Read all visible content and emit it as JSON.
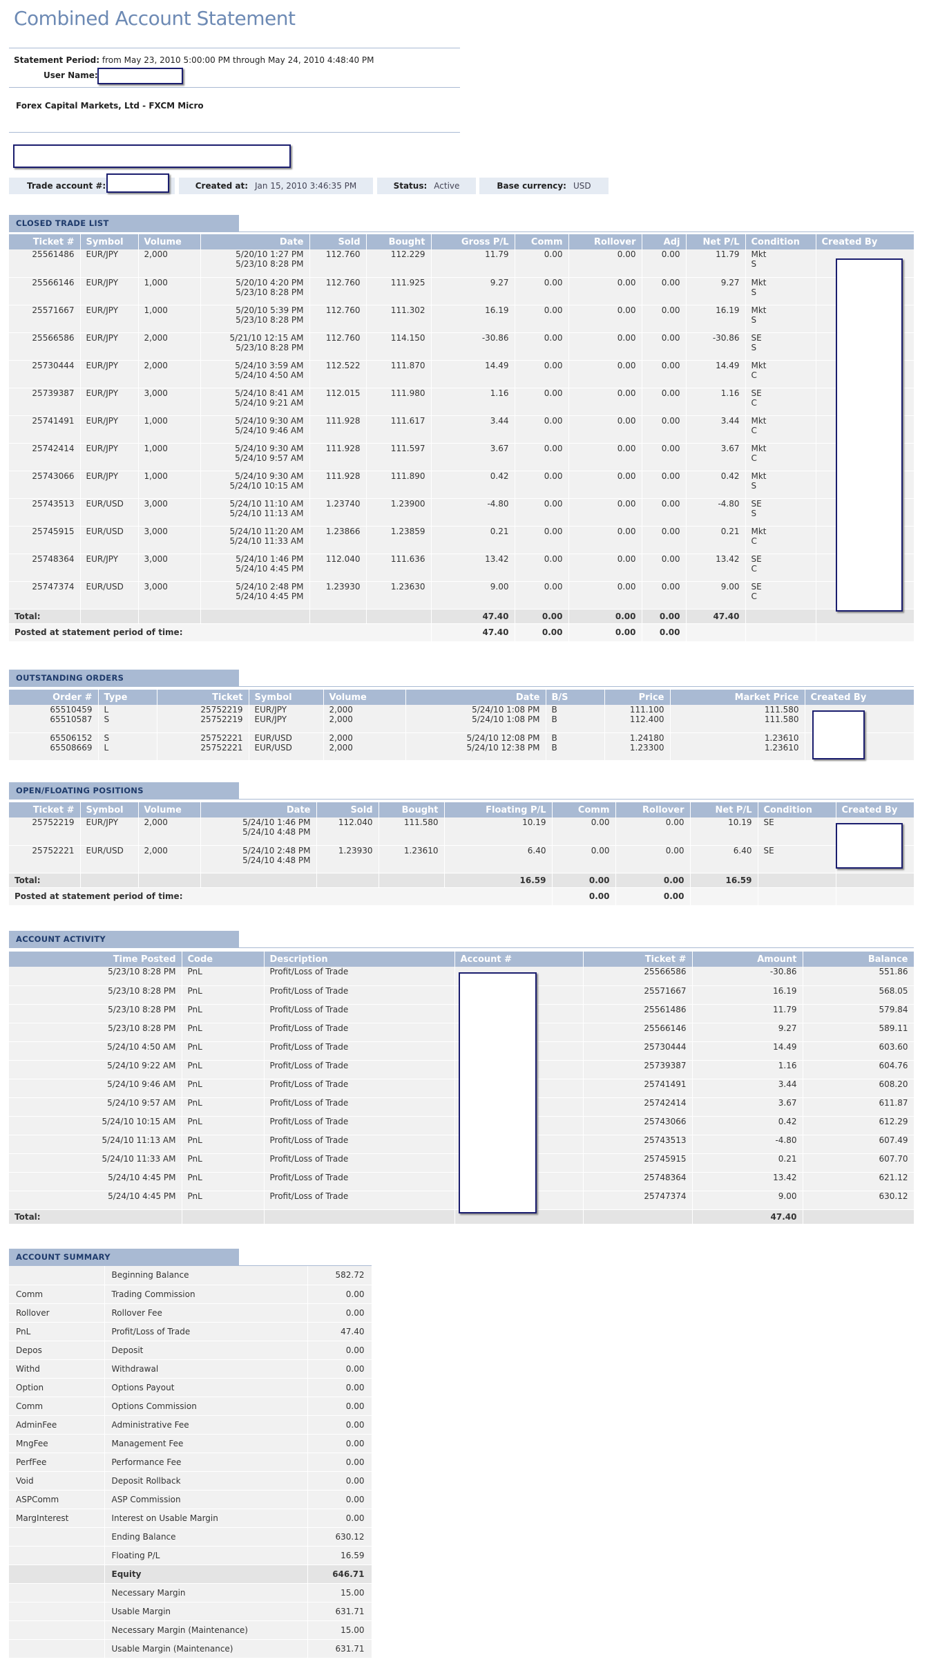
{
  "title": "Combined Account Statement",
  "period_label": "Statement Period:",
  "period_value": "from May 23, 2010 5:00:00 PM through May 24, 2010 4:48:40 PM",
  "user_label": "User Name:",
  "broker": "Forex Capital Markets, Ltd - FXCM Micro",
  "info": {
    "trade_account_label": "Trade account #:",
    "created_label": "Created at:",
    "created_value": "Jan 15, 2010 3:46:35 PM",
    "status_label": "Status:",
    "status_value": "Active",
    "currency_label": "Base currency:",
    "currency_value": "USD"
  },
  "closed": {
    "title": "CLOSED TRADE LIST",
    "headers": [
      "Ticket #",
      "Symbol",
      "Volume",
      "Date",
      "Sold",
      "Bought",
      "Gross P/L",
      "Comm",
      "Rollover",
      "Adj",
      "Net P/L",
      "Condition",
      "Created By"
    ],
    "rows": [
      [
        "25561486",
        "EUR/JPY",
        "2,000",
        "5/20/10 1:27 PM",
        "5/23/10 8:28 PM",
        "",
        "112.760",
        "112.229",
        "",
        "11.79",
        "0.00",
        "0.00",
        "0.00",
        "11.79",
        "Mkt",
        "S"
      ],
      [
        "25566146",
        "EUR/JPY",
        "1,000",
        "5/20/10 4:20 PM",
        "5/23/10 8:28 PM",
        "",
        "112.760",
        "111.925",
        "",
        "9.27",
        "0.00",
        "0.00",
        "0.00",
        "9.27",
        "Mkt",
        "S"
      ],
      [
        "25571667",
        "EUR/JPY",
        "1,000",
        "5/20/10 5:39 PM",
        "5/23/10 8:28 PM",
        "",
        "112.760",
        "111.302",
        "",
        "16.19",
        "0.00",
        "0.00",
        "0.00",
        "16.19",
        "Mkt",
        "S"
      ],
      [
        "25566586",
        "EUR/JPY",
        "2,000",
        "5/21/10 12:15 AM",
        "5/23/10 8:28 PM",
        "",
        "112.760",
        "114.150",
        "",
        "-30.86",
        "0.00",
        "0.00",
        "0.00",
        "-30.86",
        "SE",
        "S"
      ],
      [
        "25730444",
        "EUR/JPY",
        "2,000",
        "5/24/10 3:59 AM",
        "5/24/10 4:50 AM",
        "112.522",
        "",
        "",
        "111.870",
        "14.49",
        "0.00",
        "0.00",
        "0.00",
        "14.49",
        "Mkt",
        "C"
      ],
      [
        "25739387",
        "EUR/JPY",
        "3,000",
        "5/24/10 8:41 AM",
        "5/24/10 9:21 AM",
        "",
        "112.015",
        "111.980",
        "",
        "1.16",
        "0.00",
        "0.00",
        "0.00",
        "1.16",
        "SE",
        "C"
      ],
      [
        "25741491",
        "EUR/JPY",
        "1,000",
        "5/24/10 9:30 AM",
        "5/24/10 9:46 AM",
        "111.928",
        "",
        "",
        "111.617",
        "3.44",
        "0.00",
        "0.00",
        "0.00",
        "3.44",
        "Mkt",
        "C"
      ],
      [
        "25742414",
        "EUR/JPY",
        "1,000",
        "5/24/10 9:30 AM",
        "5/24/10 9:57 AM",
        "111.928",
        "",
        "",
        "111.597",
        "3.67",
        "0.00",
        "0.00",
        "0.00",
        "3.67",
        "Mkt",
        "C"
      ],
      [
        "25743066",
        "EUR/JPY",
        "1,000",
        "5/24/10 9:30 AM",
        "5/24/10 10:15 AM",
        "111.928",
        "",
        "",
        "111.890",
        "0.42",
        "0.00",
        "0.00",
        "0.00",
        "0.42",
        "Mkt",
        "S"
      ],
      [
        "25743513",
        "EUR/USD",
        "3,000",
        "5/24/10 11:10 AM",
        "5/24/10 11:13 AM",
        "",
        "1.23740",
        "1.23900",
        "",
        "-4.80",
        "0.00",
        "0.00",
        "0.00",
        "-4.80",
        "SE",
        "S"
      ],
      [
        "25745915",
        "EUR/USD",
        "3,000",
        "5/24/10 11:20 AM",
        "5/24/10 11:33 AM",
        "",
        "1.23866",
        "1.23859",
        "",
        "0.21",
        "0.00",
        "0.00",
        "0.00",
        "0.21",
        "Mkt",
        "C"
      ],
      [
        "25748364",
        "EUR/JPY",
        "3,000",
        "5/24/10 1:46 PM",
        "5/24/10 4:45 PM",
        "112.040",
        "",
        "",
        "111.636",
        "13.42",
        "0.00",
        "0.00",
        "0.00",
        "13.42",
        "SE",
        "C"
      ],
      [
        "25747374",
        "EUR/USD",
        "3,000",
        "5/24/10 2:48 PM",
        "5/24/10 4:45 PM",
        "1.23930",
        "",
        "",
        "1.23630",
        "9.00",
        "0.00",
        "0.00",
        "0.00",
        "9.00",
        "SE",
        "C"
      ]
    ],
    "total_label": "Total:",
    "total": {
      "gross": "47.40",
      "comm": "0.00",
      "rollover": "0.00",
      "adj": "0.00",
      "net": "47.40"
    },
    "posted_label": "Posted at statement period of time:",
    "posted": {
      "gross": "47.40",
      "comm": "0.00",
      "rollover": "0.00",
      "adj": "0.00"
    }
  },
  "orders": {
    "title": "OUTSTANDING ORDERS",
    "headers": [
      "Order #",
      "Type",
      "Ticket",
      "Symbol",
      "Volume",
      "Date",
      "B/S",
      "Price",
      "Market Price",
      "Created By"
    ],
    "rows": [
      [
        [
          "65510459",
          "65510587"
        ],
        [
          "L",
          "S"
        ],
        [
          "25752219",
          "25752219"
        ],
        [
          "EUR/JPY",
          "EUR/JPY"
        ],
        [
          "2,000",
          "2,000"
        ],
        [
          "5/24/10 1:08 PM",
          "5/24/10 1:08 PM"
        ],
        [
          "B",
          "B"
        ],
        [
          "111.100",
          "112.400"
        ],
        [
          "111.580",
          "111.580"
        ]
      ],
      [
        [
          "65506152",
          "65508669"
        ],
        [
          "S",
          "L"
        ],
        [
          "25752221",
          "25752221"
        ],
        [
          "EUR/USD",
          "EUR/USD"
        ],
        [
          "2,000",
          "2,000"
        ],
        [
          "5/24/10 12:08 PM",
          "5/24/10 12:38 PM"
        ],
        [
          "B",
          "B"
        ],
        [
          "1.24180",
          "1.23300"
        ],
        [
          "1.23610",
          "1.23610"
        ]
      ]
    ]
  },
  "open": {
    "title": "OPEN/FLOATING POSITIONS",
    "headers": [
      "Ticket #",
      "Symbol",
      "Volume",
      "Date",
      "Sold",
      "Bought",
      "Floating P/L",
      "Comm",
      "Rollover",
      "Net P/L",
      "Condition",
      "Created By"
    ],
    "rows": [
      [
        "25752219",
        "EUR/JPY",
        "2,000",
        "5/24/10 1:46 PM",
        "5/24/10 4:48 PM",
        "112.040",
        "111.580",
        "10.19",
        "0.00",
        "0.00",
        "10.19",
        "SE"
      ],
      [
        "25752221",
        "EUR/USD",
        "2,000",
        "5/24/10 2:48 PM",
        "5/24/10 4:48 PM",
        "1.23930",
        "1.23610",
        "6.40",
        "0.00",
        "0.00",
        "6.40",
        "SE"
      ]
    ],
    "total_label": "Total:",
    "total": {
      "floating": "16.59",
      "comm": "0.00",
      "rollover": "0.00",
      "net": "16.59"
    },
    "posted_label": "Posted at statement period of time:",
    "posted": {
      "comm": "0.00",
      "rollover": "0.00"
    }
  },
  "activity": {
    "title": "ACCOUNT ACTIVITY",
    "headers": [
      "Time Posted",
      "Code",
      "Description",
      "Account #",
      "Ticket #",
      "Amount",
      "Balance"
    ],
    "rows": [
      [
        "5/23/10 8:28 PM",
        "PnL",
        "Profit/Loss of Trade",
        "25566586",
        "-30.86",
        "551.86"
      ],
      [
        "5/23/10 8:28 PM",
        "PnL",
        "Profit/Loss of Trade",
        "25571667",
        "16.19",
        "568.05"
      ],
      [
        "5/23/10 8:28 PM",
        "PnL",
        "Profit/Loss of Trade",
        "25561486",
        "11.79",
        "579.84"
      ],
      [
        "5/23/10 8:28 PM",
        "PnL",
        "Profit/Loss of Trade",
        "25566146",
        "9.27",
        "589.11"
      ],
      [
        "5/24/10 4:50 AM",
        "PnL",
        "Profit/Loss of Trade",
        "25730444",
        "14.49",
        "603.60"
      ],
      [
        "5/24/10 9:22 AM",
        "PnL",
        "Profit/Loss of Trade",
        "25739387",
        "1.16",
        "604.76"
      ],
      [
        "5/24/10 9:46 AM",
        "PnL",
        "Profit/Loss of Trade",
        "25741491",
        "3.44",
        "608.20"
      ],
      [
        "5/24/10 9:57 AM",
        "PnL",
        "Profit/Loss of Trade",
        "25742414",
        "3.67",
        "611.87"
      ],
      [
        "5/24/10 10:15 AM",
        "PnL",
        "Profit/Loss of Trade",
        "25743066",
        "0.42",
        "612.29"
      ],
      [
        "5/24/10 11:13 AM",
        "PnL",
        "Profit/Loss of Trade",
        "25743513",
        "-4.80",
        "607.49"
      ],
      [
        "5/24/10 11:33 AM",
        "PnL",
        "Profit/Loss of Trade",
        "25745915",
        "0.21",
        "607.70"
      ],
      [
        "5/24/10 4:45 PM",
        "PnL",
        "Profit/Loss of Trade",
        "25748364",
        "13.42",
        "621.12"
      ],
      [
        "5/24/10 4:45 PM",
        "PnL",
        "Profit/Loss of Trade",
        "25747374",
        "9.00",
        "630.12"
      ]
    ],
    "total_label": "Total:",
    "total_amount": "47.40"
  },
  "summary": {
    "title": "ACCOUNT SUMMARY",
    "rows": [
      [
        "",
        "Beginning Balance",
        "582.72"
      ],
      [
        "Comm",
        "Trading Commission",
        "0.00"
      ],
      [
        "Rollover",
        "Rollover Fee",
        "0.00"
      ],
      [
        "PnL",
        "Profit/Loss of Trade",
        "47.40"
      ],
      [
        "Depos",
        "Deposit",
        "0.00"
      ],
      [
        "Withd",
        "Withdrawal",
        "0.00"
      ],
      [
        "Option",
        "Options Payout",
        "0.00"
      ],
      [
        "Comm",
        "Options Commission",
        "0.00"
      ],
      [
        "AdminFee",
        "Administrative Fee",
        "0.00"
      ],
      [
        "MngFee",
        "Management Fee",
        "0.00"
      ],
      [
        "PerfFee",
        "Performance Fee",
        "0.00"
      ],
      [
        "Void",
        "Deposit Rollback",
        "0.00"
      ],
      [
        "ASPComm",
        "ASP Commission",
        "0.00"
      ],
      [
        "MargInterest",
        "Interest on Usable Margin",
        "0.00"
      ],
      [
        "",
        "Ending Balance",
        "630.12"
      ],
      [
        "",
        "Floating P/L",
        "16.59"
      ],
      [
        "",
        "Equity",
        "646.71"
      ],
      [
        "",
        "Necessary Margin",
        "15.00"
      ],
      [
        "",
        "Usable Margin",
        "631.71"
      ],
      [
        "",
        "Necessary Margin (Maintenance)",
        "15.00"
      ],
      [
        "",
        "Usable Margin (Maintenance)",
        "631.71"
      ]
    ]
  }
}
